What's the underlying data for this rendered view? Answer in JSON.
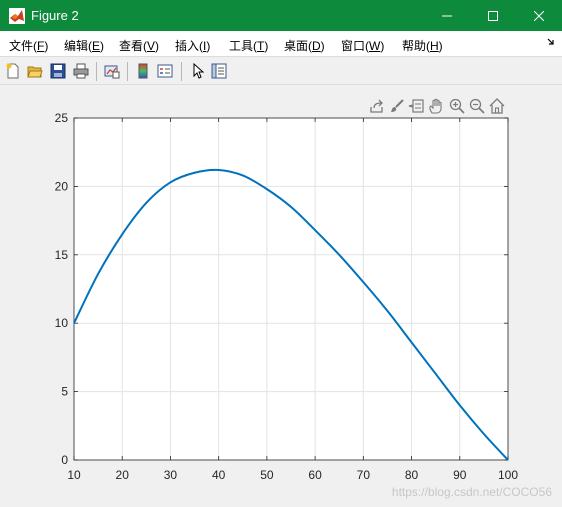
{
  "window": {
    "title": "Figure 2",
    "buttons": {
      "minimize": "minimize",
      "maximize": "maximize",
      "close": "close"
    }
  },
  "menubar": {
    "items": [
      {
        "label": "文件(",
        "key": "F",
        "suffix": ")"
      },
      {
        "label": "编辑(",
        "key": "E",
        "suffix": ")"
      },
      {
        "label": "查看(",
        "key": "V",
        "suffix": ")"
      },
      {
        "label": "插入(",
        "key": "I",
        "suffix": ")"
      },
      {
        "label": "工具(",
        "key": "T",
        "suffix": ")"
      },
      {
        "label": "桌面(",
        "key": "D",
        "suffix": ")"
      },
      {
        "label": "窗口(",
        "key": "W",
        "suffix": ")"
      },
      {
        "label": "帮助(",
        "key": "H",
        "suffix": ")"
      }
    ],
    "overflow_icon": "dock-arrow-icon"
  },
  "toolbar": {
    "icons": [
      "new-figure-icon",
      "open-file-icon",
      "save-icon",
      "print-icon",
      "link-plot-icon",
      "insert-colorbar-icon",
      "insert-legend-icon",
      "edit-plot-arrow-icon",
      "property-inspector-icon"
    ]
  },
  "axes_toolbar": {
    "icons": [
      "export-icon",
      "brush-icon",
      "data-tips-icon",
      "pan-hand-icon",
      "zoom-in-icon",
      "zoom-out-icon",
      "home-icon"
    ]
  },
  "watermark": "https://blog.csdn.net/COCO56",
  "chart_data": {
    "type": "line",
    "title": "",
    "xlabel": "",
    "ylabel": "",
    "xlim": [
      10,
      100
    ],
    "ylim": [
      0,
      25
    ],
    "xticks": [
      10,
      20,
      30,
      40,
      50,
      60,
      70,
      80,
      90,
      100
    ],
    "yticks": [
      0,
      5,
      10,
      15,
      20,
      25
    ],
    "grid": true,
    "line_color": "#0072bd",
    "series": [
      {
        "name": "",
        "x": [
          10,
          15,
          20,
          25,
          30,
          35,
          40,
          45,
          50,
          55,
          60,
          65,
          70,
          75,
          80,
          85,
          90,
          95,
          100
        ],
        "y": [
          10.0,
          13.6,
          16.5,
          18.8,
          20.3,
          21.0,
          21.2,
          20.8,
          19.8,
          18.5,
          16.8,
          15.0,
          13.0,
          10.9,
          8.6,
          6.3,
          4.0,
          1.9,
          0.0
        ]
      }
    ]
  }
}
